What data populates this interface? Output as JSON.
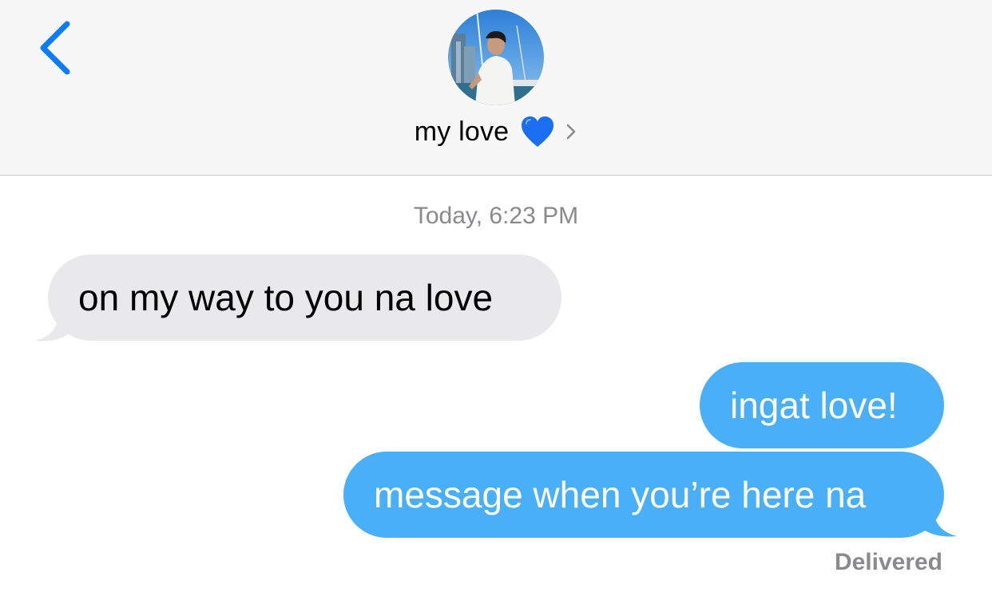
{
  "header": {
    "contact_name": "my love",
    "contact_emoji": "blue-heart",
    "avatar_icon": "contact-photo"
  },
  "thread": {
    "timestamp": "Today, 6:23 PM",
    "messages": [
      {
        "direction": "incoming",
        "text": "on my way to you na love"
      },
      {
        "direction": "outgoing",
        "text": "ingat love!"
      },
      {
        "direction": "outgoing",
        "text": "message when you’re here na"
      }
    ],
    "status": "Delivered"
  },
  "colors": {
    "accent": "#0a7cff",
    "incoming_bubble": "#e9e9eb",
    "outgoing_bubble": "#48aff8",
    "header_bg": "#f7f7f8",
    "heart": "#1a6ff0"
  }
}
